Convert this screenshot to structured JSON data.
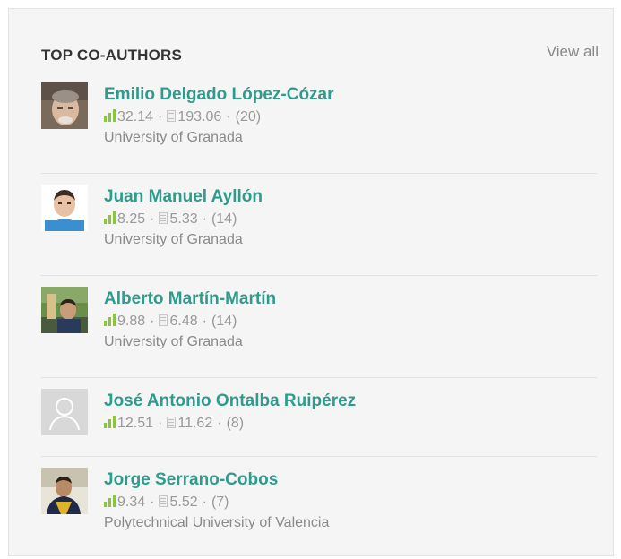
{
  "widget": {
    "title": "TOP CO-AUTHORS",
    "view_all": "View all"
  },
  "coauthors": [
    {
      "name": "Emilio Delgado López-Cózar",
      "rg_score": "32.14",
      "impact": "193.06",
      "count": "(20)",
      "affiliation": "University of Granada"
    },
    {
      "name": "Juan Manuel Ayllón",
      "rg_score": "8.25",
      "impact": "5.33",
      "count": "(14)",
      "affiliation": "University of Granada"
    },
    {
      "name": "Alberto Martín-Martín",
      "rg_score": "9.88",
      "impact": "6.48",
      "count": "(14)",
      "affiliation": "University of Granada"
    },
    {
      "name": "José Antonio Ontalba Ruipérez",
      "rg_score": "12.51",
      "impact": "11.62",
      "count": "(8)",
      "affiliation": ""
    },
    {
      "name": "Jorge Serrano-Cobos",
      "rg_score": "9.34",
      "impact": "5.52",
      "count": "(7)",
      "affiliation": "Polytechnical University of Valencia"
    }
  ],
  "colors": {
    "name_link": "#2e9b8c",
    "score_icon": "#8cc63f",
    "muted_text": "#999999",
    "panel_bg": "#f5f5f5"
  },
  "icons": {
    "score": "bar-chart-icon",
    "impact": "document-icon"
  }
}
